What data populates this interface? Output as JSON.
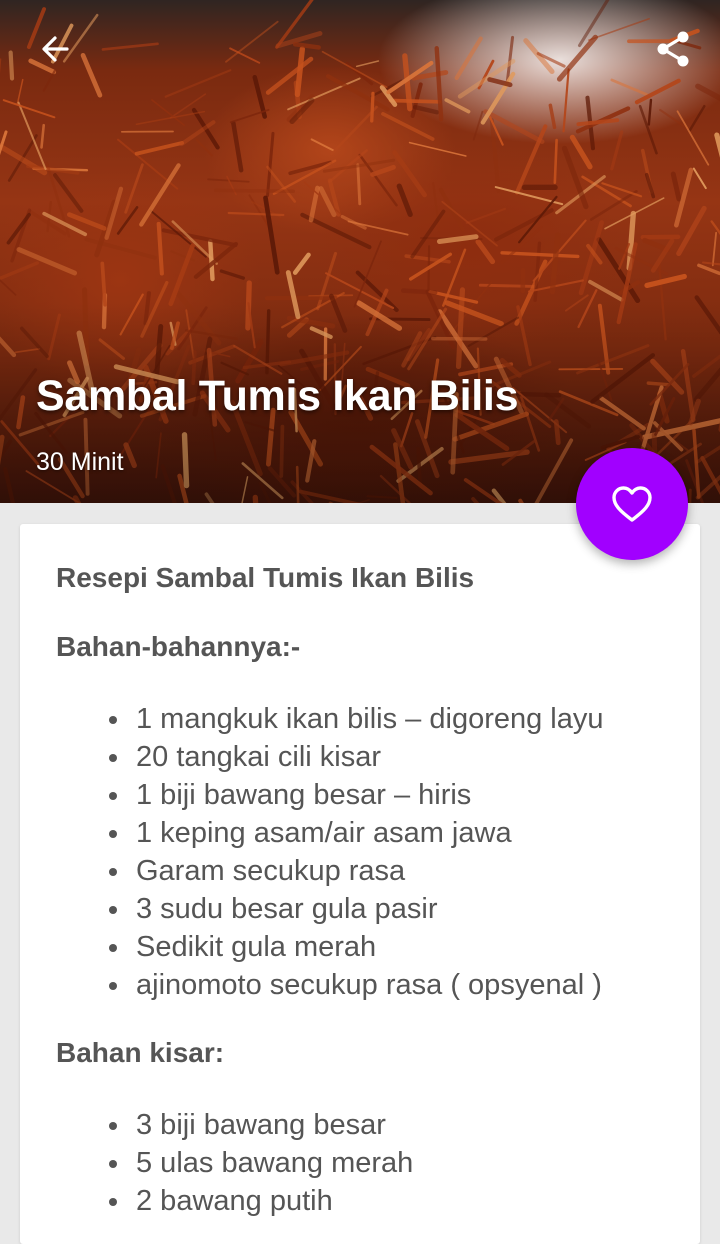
{
  "header": {
    "back_icon": "arrow-left-icon",
    "share_icon": "share-icon",
    "title": "Sambal Tumis Ikan Bilis",
    "time": "30 Minit"
  },
  "fab": {
    "icon": "heart-outline-icon",
    "color": "#a100ff"
  },
  "recipe": {
    "heading": "Resepi Sambal Tumis Ikan Bilis",
    "sections": [
      {
        "label": "Bahan-bahannya:-",
        "items": [
          "1 mangkuk ikan bilis – digoreng layu",
          "20 tangkai cili kisar",
          "1 biji bawang besar – hiris",
          "1 keping asam/air asam jawa",
          "Garam secukup rasa",
          "3 sudu besar gula pasir",
          "Sedikit gula merah",
          "ajinomoto secukup rasa ( opsyenal )"
        ]
      },
      {
        "label": "Bahan kisar:",
        "items": [
          "3 biji bawang besar",
          "5 ulas bawang merah",
          "2 bawang putih"
        ]
      }
    ]
  }
}
